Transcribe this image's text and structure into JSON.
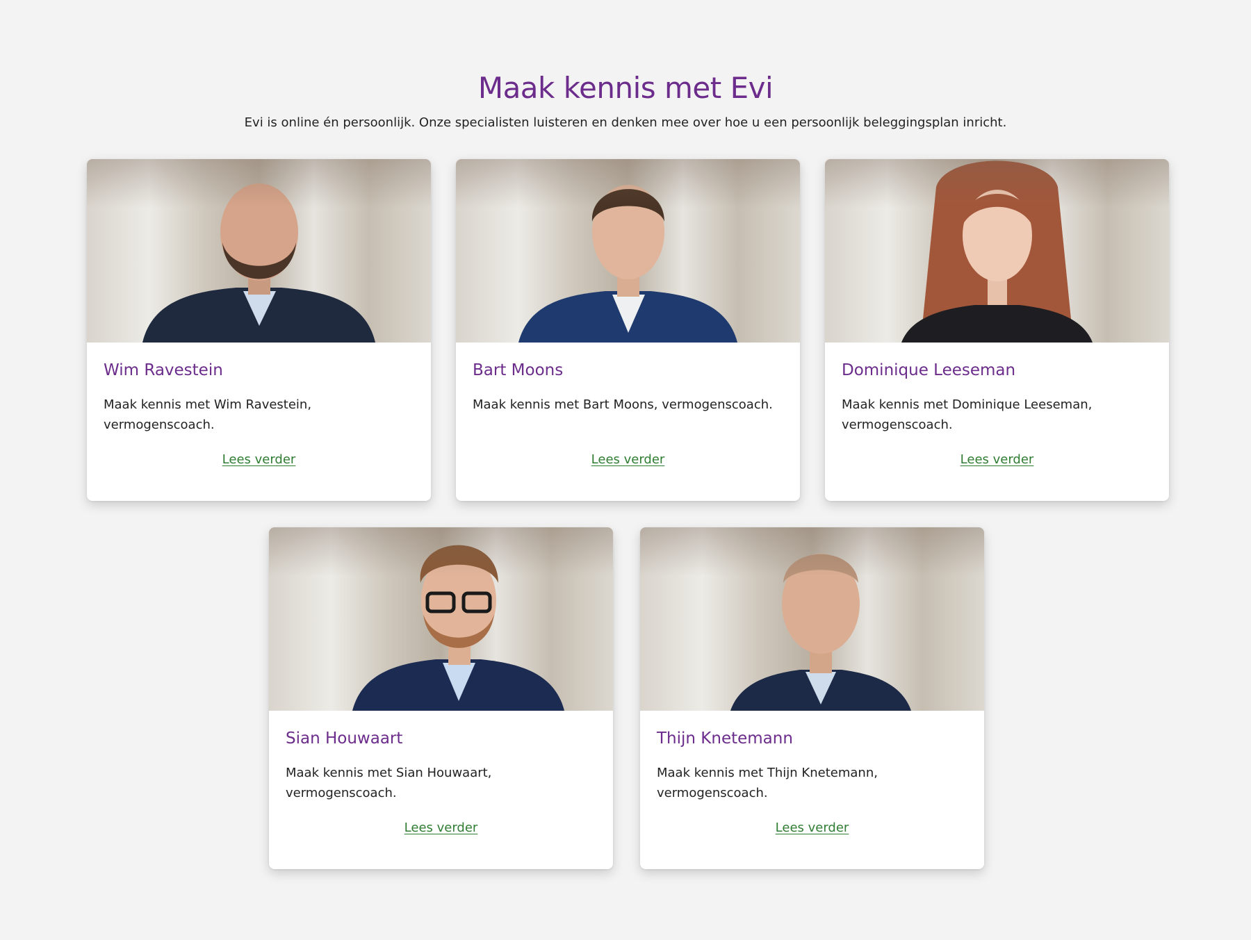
{
  "section": {
    "title": "Maak kennis met Evi",
    "intro": "Evi is online én persoonlijk. Onze specialisten luisteren en denken mee over hoe u een persoonlijk beleggingsplan inricht."
  },
  "cards": [
    {
      "name": "Wim Ravestein",
      "text": "Maak kennis met Wim Ravestein, vermogenscoach.",
      "link": "Lees verder",
      "photo_icon": "person-photo"
    },
    {
      "name": "Bart Moons",
      "text": "Maak kennis met Bart Moons, vermogenscoach.",
      "link": "Lees verder",
      "photo_icon": "person-photo"
    },
    {
      "name": "Dominique Leeseman",
      "text": "Maak kennis met Dominique Leeseman, vermogenscoach.",
      "link": "Lees verder",
      "photo_icon": "person-photo"
    },
    {
      "name": "Sian Houwaart",
      "text": "Maak kennis met Sian Houwaart, vermogenscoach.",
      "link": "Lees verder",
      "photo_icon": "person-photo"
    },
    {
      "name": "Thijn Knetemann",
      "text": "Maak kennis met Thijn Knetemann, vermogenscoach.",
      "link": "Lees verder",
      "photo_icon": "person-photo"
    }
  ],
  "colors": {
    "accent_purple": "#6b2c8b",
    "link_green": "#2f7d32",
    "page_background": "#f3f3f3",
    "card_background": "#ffffff"
  }
}
